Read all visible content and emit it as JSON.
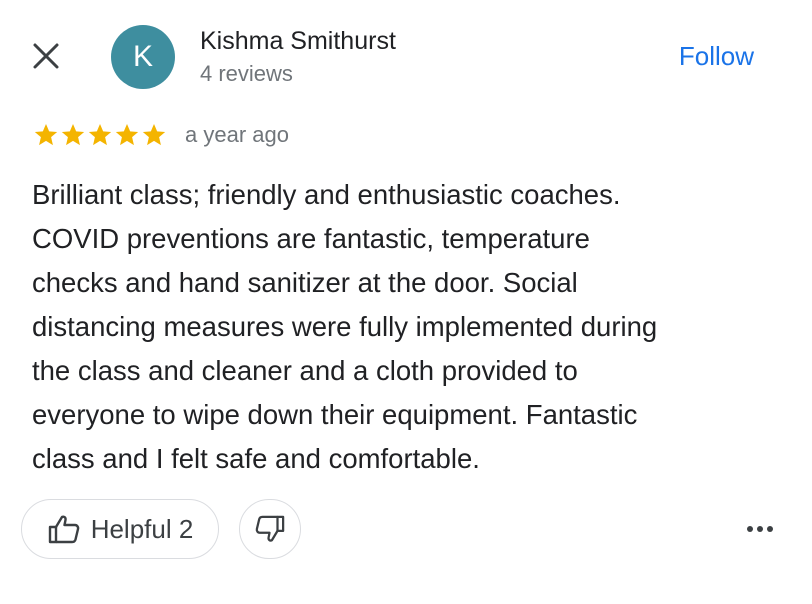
{
  "header": {
    "close_icon": "close-icon",
    "avatar_initial": "K",
    "avatar_color": "#3e8e9f",
    "reviewer_name": "Kishma Smithurst",
    "review_count": "4 reviews",
    "follow_label": "Follow",
    "accent_color": "#1a73e8"
  },
  "review": {
    "rating": 5,
    "max_rating": 5,
    "star_color": "#f4b400",
    "date": "a year ago",
    "text_lines": [
      "Brilliant class; friendly and enthusiastic coaches.",
      "COVID preventions are fantastic, temperature",
      "checks and hand sanitizer at the door. Social",
      "distancing measures were fully implemented during",
      "the class and cleaner and a cloth provided to",
      "everyone to wipe down their equipment. Fantastic",
      "class and I felt safe and comfortable."
    ]
  },
  "actions": {
    "helpful_label": "Helpful 2",
    "helpful_icon": "thumbs-up-icon",
    "thumbs_down_icon": "thumbs-down-icon",
    "more_icon": "more-horizontal-icon"
  }
}
